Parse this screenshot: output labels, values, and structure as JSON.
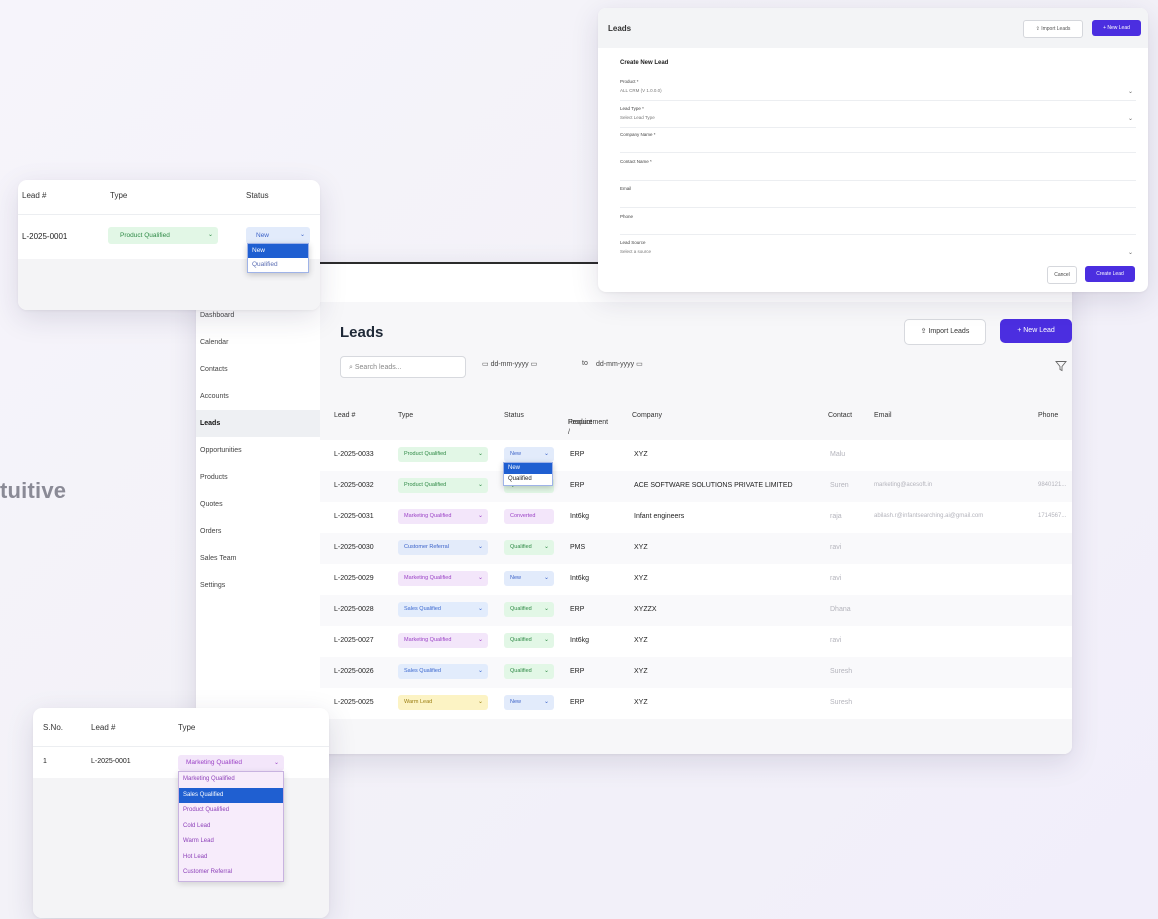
{
  "hero_word": "tuitive",
  "sidebar": {
    "items": [
      {
        "label": "Dashboard"
      },
      {
        "label": "Calendar"
      },
      {
        "label": "Contacts"
      },
      {
        "label": "Accounts"
      },
      {
        "label": "Leads",
        "active": true
      },
      {
        "label": "Opportunities"
      },
      {
        "label": "Products"
      },
      {
        "label": "Quotes"
      },
      {
        "label": "Orders"
      },
      {
        "label": "Sales Team"
      },
      {
        "label": "Settings"
      }
    ]
  },
  "main": {
    "title": "Leads",
    "import_label": "Import Leads",
    "new_label": "+ New Lead",
    "search_placeholder": "Search leads...",
    "date_from": "dd-mm-yyyy",
    "date_to_sep": "to",
    "date_to": "dd-mm-yyyy",
    "columns": {
      "lead": "Lead #",
      "type": "Type",
      "status": "Status",
      "product": "Product /",
      "product2": "Requirement",
      "company": "Company",
      "contact": "Contact",
      "email": "Email",
      "phone": "Phone"
    },
    "rows": [
      {
        "lead": "L-2025-0033",
        "type": "Product Qualified",
        "tclass": "product",
        "status": "New",
        "sclass": "new",
        "product": "ERP",
        "company": "XYZ",
        "contact": "Malu",
        "email": "",
        "phone": ""
      },
      {
        "lead": "L-2025-0032",
        "type": "Product Qualified",
        "tclass": "product",
        "status": "Qualified",
        "sclass": "qualified",
        "product": "ERP",
        "company": "ACE SOFTWARE SOLUTIONS PRIVATE LIMITED",
        "contact": "Suren",
        "email": "marketing@acesoft.in",
        "phone": "9840121..."
      },
      {
        "lead": "L-2025-0031",
        "type": "Marketing Qualified",
        "tclass": "marketing",
        "status": "Converted",
        "sclass": "converted",
        "product": "Int6kg",
        "company": "Infant engineers",
        "contact": "raja",
        "email": "abilash.r@infantsearching.ai@gmail.com",
        "phone": "1714567..."
      },
      {
        "lead": "L-2025-0030",
        "type": "Customer Referral",
        "tclass": "customer",
        "status": "Qualified",
        "sclass": "qualified",
        "product": "PMS",
        "company": "XYZ",
        "contact": "ravi",
        "email": "",
        "phone": ""
      },
      {
        "lead": "L-2025-0029",
        "type": "Marketing Qualified",
        "tclass": "marketing",
        "status": "New",
        "sclass": "new",
        "product": "Int6kg",
        "company": "XYZ",
        "contact": "ravi",
        "email": "",
        "phone": ""
      },
      {
        "lead": "L-2025-0028",
        "type": "Sales Qualified",
        "tclass": "sales",
        "status": "Qualified",
        "sclass": "qualified",
        "product": "ERP",
        "company": "XYZZX",
        "contact": "Dhana",
        "email": "",
        "phone": ""
      },
      {
        "lead": "L-2025-0027",
        "type": "Marketing Qualified",
        "tclass": "marketing",
        "status": "Qualified",
        "sclass": "qualified",
        "product": "Int6kg",
        "company": "XYZ",
        "contact": "ravi",
        "email": "",
        "phone": ""
      },
      {
        "lead": "L-2025-0026",
        "type": "Sales Qualified",
        "tclass": "sales",
        "status": "Qualified",
        "sclass": "qualified",
        "product": "ERP",
        "company": "XYZ",
        "contact": "Suresh",
        "email": "",
        "phone": ""
      },
      {
        "lead": "L-2025-0025",
        "type": "Warm Lead",
        "tclass": "warm",
        "status": "New",
        "sclass": "new",
        "product": "ERP",
        "company": "XYZ",
        "contact": "Suresh",
        "email": "",
        "phone": ""
      }
    ],
    "status_dropdown": [
      "New",
      "Qualified"
    ]
  },
  "create": {
    "header_title": "Leads",
    "import_label": "Import Leads",
    "new_label": "+ New Lead",
    "form_title": "Create New Lead",
    "product_label": "Product *",
    "product_value": "ALL CRM (V 1.0.0.0)",
    "lead_type_label": "Lead Type *",
    "lead_type_value": "Select Lead Type",
    "company_label": "Company Name *",
    "contact_label": "Contact Name *",
    "email_label": "Email",
    "phone_label": "Phone",
    "source_label": "Lead Source",
    "source_value": "Select a source",
    "cancel_label": "Cancel",
    "create_label": "Create Lead"
  },
  "status_card": {
    "col_lead": "Lead #",
    "col_type": "Type",
    "col_status": "Status",
    "lead": "L-2025-0001",
    "type": "Product Qualified",
    "status": "New",
    "options": [
      "New",
      "Qualified"
    ]
  },
  "type_card": {
    "col_sno": "S.No.",
    "col_lead": "Lead #",
    "col_type": "Type",
    "sno": "1",
    "lead": "L-2025-0001",
    "type": "Marketing Qualified",
    "options": [
      "Marketing Qualified",
      "Sales Qualified",
      "Product Qualified",
      "Cold Lead",
      "Warm Lead",
      "Hot Lead",
      "Customer Referral"
    ]
  }
}
